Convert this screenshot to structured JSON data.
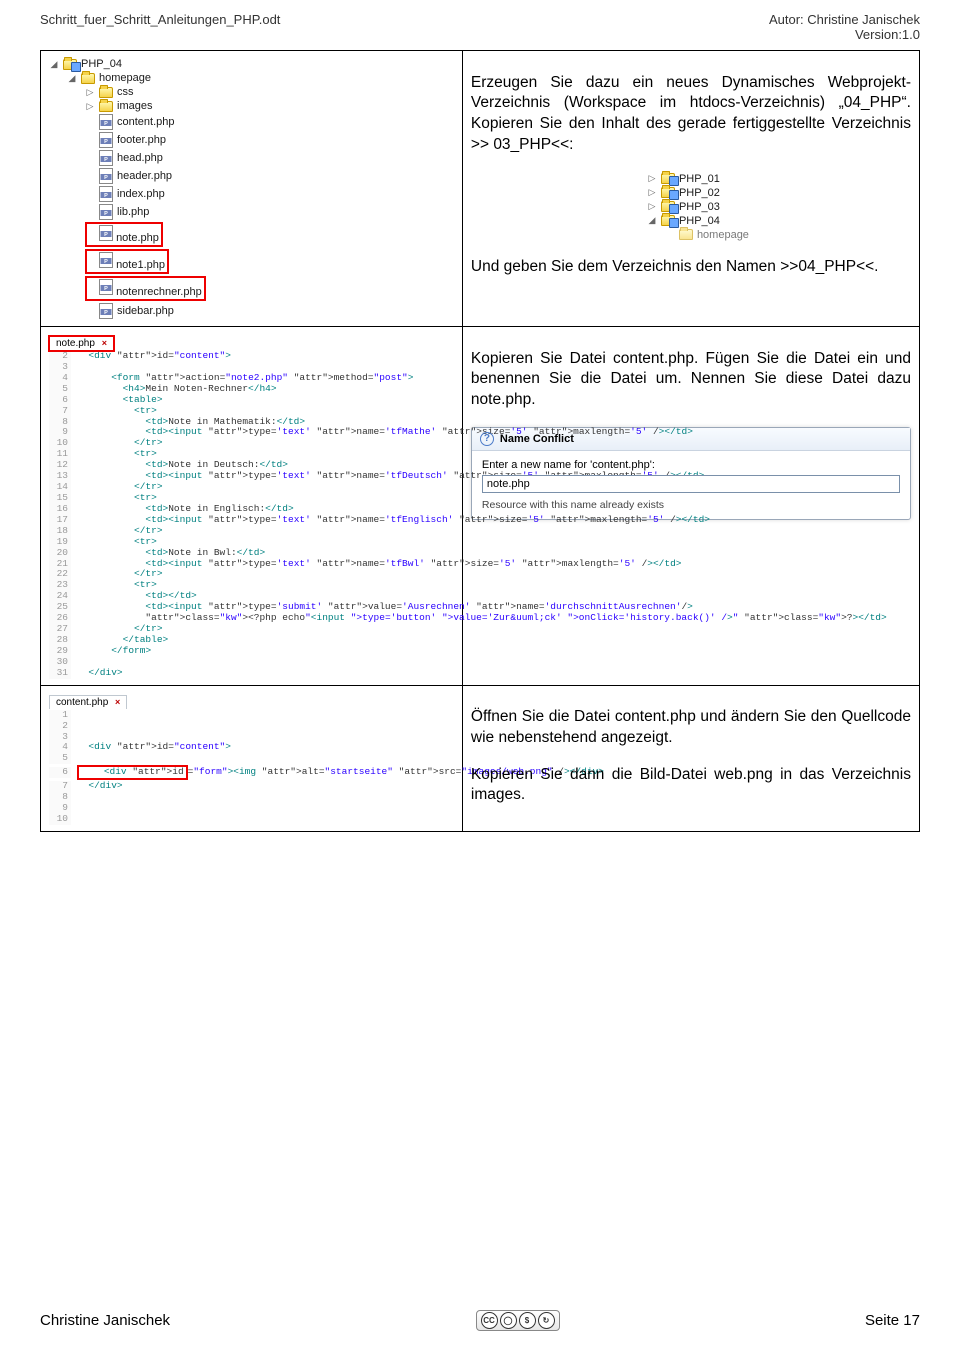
{
  "header": {
    "doc_title": "Schritt_fuer_Schritt_Anleitungen_PHP.odt",
    "author_line": "Autor: Christine Janischek",
    "version_line": "Version:1.0"
  },
  "footer": {
    "author": "Christine Janischek",
    "page": "Seite 17",
    "cc_label": "CC",
    "cc_tags": [
      "BY",
      "NC",
      "SA"
    ]
  },
  "row1": {
    "text_p1": "Erzeugen Sie dazu ein neues Dynamisches Webprojekt-Verzeichnis (Workspace im ht­docs-Verzeichnis) „04_PHP“. Kopieren Sie den Inhalt des gerade fertiggestellte Ver­zeichnis >> 03_PHP<<:",
    "text_p2": "Und geben Sie dem Verzeichnis den Namen >>04_PHP<<.",
    "tree_root": "PHP_04",
    "tree_items": [
      {
        "lvl": 1,
        "label": "homepage",
        "type": "folder",
        "exp": "down"
      },
      {
        "lvl": 2,
        "label": "css",
        "type": "folder",
        "exp": "right"
      },
      {
        "lvl": 2,
        "label": "images",
        "type": "folder",
        "exp": "right"
      },
      {
        "lvl": 2,
        "label": "content.php",
        "type": "php"
      },
      {
        "lvl": 2,
        "label": "footer.php",
        "type": "php"
      },
      {
        "lvl": 2,
        "label": "head.php",
        "type": "php"
      },
      {
        "lvl": 2,
        "label": "header.php",
        "type": "php"
      },
      {
        "lvl": 2,
        "label": "index.php",
        "type": "php"
      },
      {
        "lvl": 2,
        "label": "lib.php",
        "type": "php"
      },
      {
        "lvl": 2,
        "label": "note.php",
        "type": "php",
        "boxed": true
      },
      {
        "lvl": 2,
        "label": "note1.php",
        "type": "php",
        "boxed": true
      },
      {
        "lvl": 2,
        "label": "notenrechner.php",
        "type": "php",
        "boxed": true
      },
      {
        "lvl": 2,
        "label": "sidebar.php",
        "type": "php"
      }
    ],
    "mini_tree": [
      "PHP_01",
      "PHP_02",
      "PHP_03",
      "PHP_04"
    ],
    "mini_sub": "homepage"
  },
  "row2": {
    "text": "Kopieren Sie Datei content.php. Fügen Sie die Datei ein und benennen Sie die Datei um. Nennen Sie diese Datei dazu note.php.",
    "tab_name": "note.php",
    "dlg_title": "Name Conflict",
    "dlg_prompt": "Enter a new name for 'content.php':",
    "dlg_value": "note.php",
    "dlg_msg": "Resource with this name already exists",
    "code_lines": [
      {
        "n": 2,
        "raw": "<div id=\"content\">",
        "indent": 1
      },
      {
        "n": 3,
        "raw": "",
        "indent": 0
      },
      {
        "n": 4,
        "raw": "<form action=\"note2.php\" method=\"post\">",
        "indent": 3
      },
      {
        "n": 5,
        "raw": "<h4>Mein Noten-Rechner</h4>",
        "indent": 4
      },
      {
        "n": 6,
        "raw": "<table>",
        "indent": 4
      },
      {
        "n": 7,
        "raw": "<tr>",
        "indent": 5
      },
      {
        "n": 8,
        "raw": "<td>Note in Mathematik:</td>",
        "indent": 6
      },
      {
        "n": 9,
        "raw": "<td><input type='text' name='tfMathe' size='5' maxlength='5' /></td>",
        "indent": 6
      },
      {
        "n": 10,
        "raw": "</tr>",
        "indent": 5
      },
      {
        "n": 11,
        "raw": "<tr>",
        "indent": 5
      },
      {
        "n": 12,
        "raw": "<td>Note in Deutsch:</td>",
        "indent": 6
      },
      {
        "n": 13,
        "raw": "<td><input type='text' name='tfDeutsch' size='5' maxlength='5' /></td>",
        "indent": 6
      },
      {
        "n": 14,
        "raw": "</tr>",
        "indent": 5
      },
      {
        "n": 15,
        "raw": "<tr>",
        "indent": 5
      },
      {
        "n": 16,
        "raw": "<td>Note in Englisch:</td>",
        "indent": 6
      },
      {
        "n": 17,
        "raw": "<td><input type='text' name='tfEnglisch' size='5' maxlength='5' /></td>",
        "indent": 6
      },
      {
        "n": 18,
        "raw": "</tr>",
        "indent": 5
      },
      {
        "n": 19,
        "raw": "<tr>",
        "indent": 5
      },
      {
        "n": 20,
        "raw": "<td>Note in Bwl:</td>",
        "indent": 6
      },
      {
        "n": 21,
        "raw": "<td><input type='text' name='tfBwl' size='5' maxlength='5' /></td>",
        "indent": 6
      },
      {
        "n": 22,
        "raw": "</tr>",
        "indent": 5
      },
      {
        "n": 23,
        "raw": "<tr>",
        "indent": 5
      },
      {
        "n": 24,
        "raw": "<td></td>",
        "indent": 6
      },
      {
        "n": 25,
        "raw": "<td><input type='submit' value='Ausrechnen' name='durchschnittAusrechnen'/>",
        "indent": 6
      },
      {
        "n": 26,
        "raw": "<?php echo\"<input type='button' value='Zur&uuml;ck' onClick='history.back()' />\" ?></td>",
        "indent": 6
      },
      {
        "n": 27,
        "raw": "</tr>",
        "indent": 5
      },
      {
        "n": 28,
        "raw": "</table>",
        "indent": 4
      },
      {
        "n": 29,
        "raw": "</form>",
        "indent": 3
      },
      {
        "n": 30,
        "raw": "",
        "indent": 0
      },
      {
        "n": 31,
        "raw": "</div>",
        "indent": 1
      }
    ]
  },
  "row3": {
    "text_p1": "Öffnen Sie die Datei content.php und än­dern Sie den Quellcode wie nebenstehend angezeigt.",
    "text_p2": "Kopieren Sie dann die Bild-Datei web.png in das Verzeichnis images.",
    "tab_name": "content.php",
    "code_lines": [
      {
        "n": 1,
        "raw": ""
      },
      {
        "n": 2,
        "raw": ""
      },
      {
        "n": 3,
        "raw": ""
      },
      {
        "n": 4,
        "raw": "<div id=\"content\">",
        "indent": 1
      },
      {
        "n": 5,
        "raw": ""
      },
      {
        "n": 6,
        "raw": "<div id=\"form\"><img alt=\"startseite\" src=\"images/web.png\" /></div>",
        "indent": 2,
        "highlight": true
      },
      {
        "n": 7,
        "raw": "</div>",
        "indent": 1
      },
      {
        "n": 8,
        "raw": ""
      },
      {
        "n": 9,
        "raw": ""
      },
      {
        "n": 10,
        "raw": ""
      }
    ]
  }
}
